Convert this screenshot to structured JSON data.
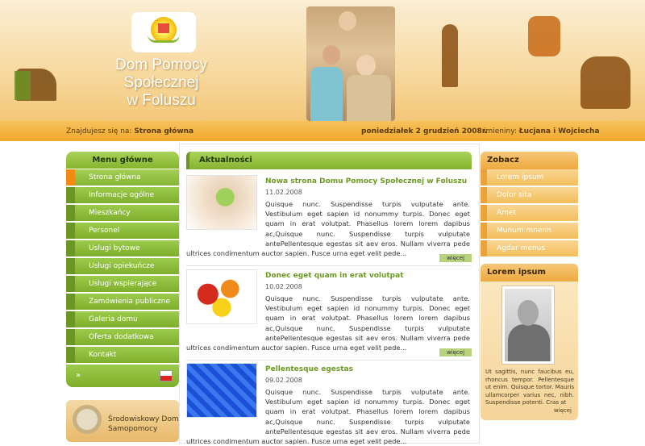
{
  "header": {
    "title_line1": "Dom Pomocy Społecznej",
    "title_line2": "w Foluszu"
  },
  "infobar": {
    "location_prefix": "Znajdujesz się na:",
    "location_current": "Strona główna",
    "date": "poniedziałek 2 grudzień 2008r.",
    "nameday_prefix": "imieniny:",
    "nameday_names": "Łucjana i Wojciecha"
  },
  "menu": {
    "title": "Menu główne",
    "items": [
      "Strona główna",
      "Informacje ogólne",
      "Mieszkańcy",
      "Personel",
      "Usługi bytowe",
      "Usługi opiekuńcze",
      "Usługi wspierające",
      "Zamówienia publiczne",
      "Galeria domu",
      "Oferta dodatkowa",
      "Kontakt"
    ],
    "bottom_arrow": "»"
  },
  "promo": {
    "line1": "Środowiskowy Dom",
    "line2": "Samopomocy"
  },
  "news": {
    "title": "Aktualności",
    "more_label": "więcej",
    "items": [
      {
        "title": "Nowa strona Domu Pomocy Społecznej w Foluszu",
        "date": "11.02.2008",
        "body": "Quisque nunc. Suspendisse turpis vulputate ante. Vestibulum eget sapien id nonummy turpis. Donec eget quam in erat volutpat. Phasellus lorem lorem dapibus ac,Quisque nunc. Suspendisse turpis vulputate antePellentesque egestas sit aev eros. Nullam viverra pede ultrices condimentum auctor sapien. Fusce urna eget velit pede..."
      },
      {
        "title": "Donec eget quam in erat volutpat",
        "date": "10.02.2008",
        "body": "Quisque nunc. Suspendisse turpis vulputate ante. Vestibulum eget sapien id nonummy turpis. Donec eget quam in erat volutpat. Phasellus lorem lorem dapibus ac,Quisque nunc. Suspendisse turpis vulputate antePellentesque egestas sit aev eros. Nullam viverra pede ultrices condimentum auctor sapien. Fusce urna eget velit pede..."
      },
      {
        "title": "Pellentesque egestas",
        "date": "09.02.2008",
        "body": "Quisque nunc. Suspendisse turpis vulputate ante. Vestibulum eget sapien id nonummy turpis. Donec eget quam in erat volutpat. Phasellus lorem lorem dapibus ac,Quisque nunc. Suspendisse turpis vulputate antePellentesque egestas sit aev eros. Nullam viverra pede ultrices condimentum auctor sapien. Fusce urna eget velit pede..."
      }
    ]
  },
  "zobacz": {
    "title": "Zobacz",
    "items": [
      "Lorem ipsum",
      "Dolor sita",
      "Amet",
      "Munum mnenn",
      "Agdar menus"
    ]
  },
  "sidebar_box": {
    "title": "Lorem ipsum",
    "text": "Ut sagittis, nunc faucibus eu, rhoncus tempor. Pellentesque ut enim. Quisque tortor. Mauris ullamcorper varius nec, nibh. Suspendisse potenti. Cras at",
    "more": "więcej"
  },
  "colors": {
    "green_accent": "#86b32e",
    "orange_accent": "#f1a92c",
    "link_green": "#6c9a21"
  }
}
